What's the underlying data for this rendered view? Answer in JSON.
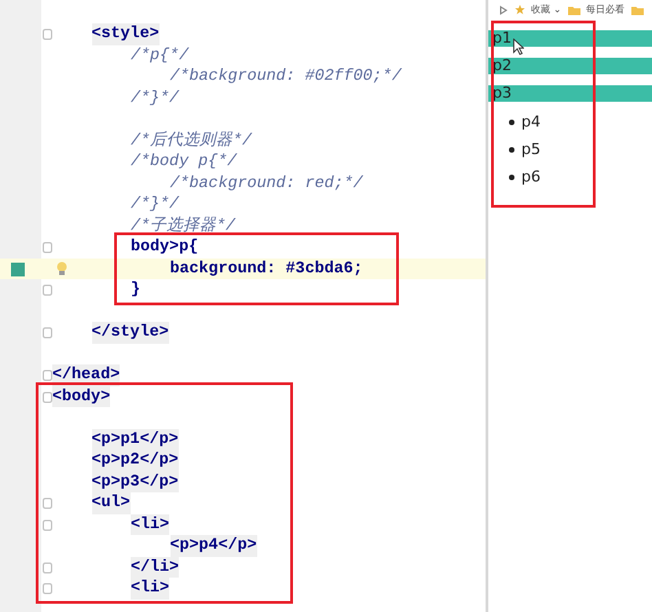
{
  "editor": {
    "lines": [
      {
        "kind": "hidden",
        "children": [
          {
            "text": "<style>",
            "kind": "tag",
            "fold": true,
            "current": false,
            "children": [
              {
                "text": "/*p{*/",
                "kind": "comment",
                "fold": false,
                "current": false,
                "children": [
                  {
                    "text": "/*background: #02ff00;*/",
                    "kind": "comment",
                    "fold": false,
                    "current": false
                  }
                ]
              },
              {
                "text": "/*}*/",
                "kind": "comment",
                "fold": false,
                "current": false
              },
              {
                "kind": "blank",
                "fold": false,
                "current": false
              },
              {
                "text": "/*后代选则器*/",
                "kind": "comment",
                "fold": false,
                "current": false
              },
              {
                "text": "/*body p{*/",
                "kind": "comment",
                "fold": false,
                "current": false,
                "children": [
                  {
                    "text": "/*background: red;*/",
                    "kind": "comment",
                    "fold": false,
                    "current": false
                  }
                ]
              },
              {
                "text": "/*}*/",
                "kind": "comment",
                "fold": false,
                "current": false
              },
              {
                "text": "/*子选择器*/",
                "kind": "comment",
                "fold": false,
                "current": false
              },
              {
                "kind": "box",
                "children": [
                  {
                    "text": "body>p{",
                    "kind": "css",
                    "fold": true,
                    "current": false,
                    "children": [
                      {
                        "text": "background: #3cbda6;",
                        "kind": "css",
                        "fold": false,
                        "current": true
                      }
                    ]
                  },
                  {
                    "text": "}",
                    "kind": "css",
                    "fold": true,
                    "current": false
                  }
                ]
              }
            ]
          },
          {
            "kind": "blank",
            "fold": false,
            "current": false
          },
          {
            "text": "</style>",
            "kind": "tag",
            "fold": true,
            "current": false
          },
          {
            "kind": "blank",
            "fold": false,
            "current": false
          }
        ]
      },
      {
        "text": "</head>",
        "kind": "tag",
        "fold": true,
        "current": false
      },
      {
        "kind": "box",
        "children": [
          {
            "text": "<body>",
            "kind": "tag",
            "fold": true,
            "current": false,
            "children": [
              {
                "kind": "blank",
                "fold": false,
                "current": false
              },
              {
                "text": "<p>p1</p>",
                "kind": "tag",
                "fold": false,
                "current": false
              },
              {
                "text": "<p>p2</p>",
                "kind": "tag",
                "fold": false,
                "current": false
              },
              {
                "text": "<p>p3</p>",
                "kind": "tag",
                "fold": false,
                "current": false
              },
              {
                "text": "<ul>",
                "kind": "tag",
                "fold": true,
                "current": false,
                "children": [
                  {
                    "text": "<li>",
                    "kind": "tag",
                    "fold": true,
                    "current": false,
                    "children": [
                      {
                        "text": "<p>p4</p>",
                        "kind": "tag",
                        "fold": false,
                        "current": false
                      }
                    ]
                  },
                  {
                    "text": "</li>",
                    "kind": "tag",
                    "fold": true,
                    "current": false
                  },
                  {
                    "text": "<li>",
                    "kind": "tag",
                    "fold": true,
                    "current": false
                  }
                ]
              }
            ]
          }
        ]
      }
    ]
  },
  "preview": {
    "bookmarks": [
      {
        "label": "收藏 ⌄",
        "kind": "star"
      },
      {
        "label": "每日必看",
        "kind": "folder"
      },
      {
        "kind": "folder"
      }
    ],
    "items": [
      {
        "text": "p1",
        "kind": "paragraph"
      },
      {
        "text": "p2",
        "kind": "paragraph"
      },
      {
        "text": "p3",
        "kind": "paragraph"
      },
      {
        "text": "p4",
        "kind": "list-item"
      },
      {
        "text": "p5",
        "kind": "list-item"
      },
      {
        "text": "p6",
        "kind": "list-item"
      }
    ],
    "annotation": true
  }
}
